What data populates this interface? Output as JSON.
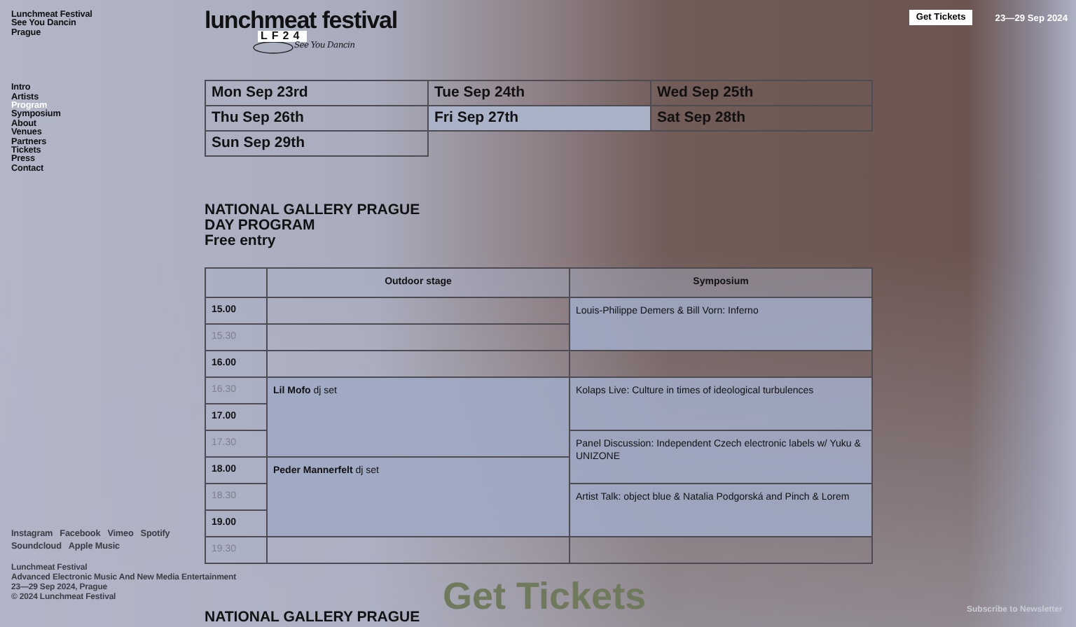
{
  "sidebar": {
    "site_lines": [
      "Lunchmeat Festival",
      "See You Dancin",
      "Prague"
    ],
    "nav": [
      {
        "label": "Intro",
        "selected": false
      },
      {
        "label": "Artists",
        "selected": false
      },
      {
        "label": "Program",
        "selected": true
      },
      {
        "label": "Symposium",
        "selected": false
      },
      {
        "label": "About",
        "selected": false
      },
      {
        "label": "Venues",
        "selected": false
      },
      {
        "label": "Partners",
        "selected": false
      },
      {
        "label": "Tickets",
        "selected": false
      },
      {
        "label": "Press",
        "selected": false
      },
      {
        "label": "Contact",
        "selected": false
      }
    ],
    "social": [
      "Instagram",
      "Facebook",
      "Vimeo",
      "Spotify",
      "Soundcloud",
      "Apple Music"
    ],
    "footer": [
      "Lunchmeat Festival",
      "Advanced Electronic Music And New Media Entertainment",
      "23—29 Sep 2024, Prague",
      "© 2024 Lunchmeat Festival"
    ]
  },
  "logo": {
    "title": "lunchmeat festival",
    "badge": "LF24",
    "script": "See You Dancin"
  },
  "header": {
    "button": "Get Tickets",
    "dates": "23—29 Sep 2024"
  },
  "days": [
    {
      "label": "Mon Sep 23rd",
      "selected": false
    },
    {
      "label": "Tue Sep 24th",
      "selected": false
    },
    {
      "label": "Wed Sep 25th",
      "selected": false
    },
    {
      "label": "Thu Sep 26th",
      "selected": false
    },
    {
      "label": "Fri Sep 27th",
      "selected": true
    },
    {
      "label": "Sat Sep 28th",
      "selected": false
    },
    {
      "label": "Sun Sep 29th",
      "selected": false
    }
  ],
  "venue": {
    "lines": [
      "NATIONAL GALLERY PRAGUE",
      "DAY PROGRAM",
      "Free entry"
    ]
  },
  "table": {
    "columns": [
      "Outdoor stage",
      "Symposium"
    ],
    "times": [
      {
        "text": "15.00",
        "kind": "hour"
      },
      {
        "text": "15.30",
        "kind": "half"
      },
      {
        "text": "16.00",
        "kind": "hour"
      },
      {
        "text": "16.30",
        "kind": "half"
      },
      {
        "text": "17.00",
        "kind": "hour"
      },
      {
        "text": "17.30",
        "kind": "half"
      },
      {
        "text": "18.00",
        "kind": "hour"
      },
      {
        "text": "18.30",
        "kind": "half"
      },
      {
        "text": "19.00",
        "kind": "hour"
      },
      {
        "text": "19.30",
        "kind": "half"
      }
    ],
    "stages": [
      [
        {
          "kind": "empty"
        },
        {
          "kind": "empty"
        },
        {
          "kind": "empty"
        },
        {
          "kind": "event",
          "text": "**Lil Mofo** dj set"
        },
        {
          "kind": "continued"
        },
        {
          "kind": "continued"
        },
        {
          "kind": "event",
          "text": "**Peder Mannerfelt** dj set"
        },
        {
          "kind": "continued"
        },
        {
          "kind": "continued"
        },
        {
          "kind": "empty"
        }
      ],
      [
        {
          "kind": "event",
          "text": "Louis-Philippe Demers & Bill Vorn: Inferno"
        },
        {
          "kind": "continued"
        },
        {
          "kind": "empty"
        },
        {
          "kind": "event",
          "text": "Kolaps Live: Culture in times of ideological turbulences"
        },
        {
          "kind": "continued"
        },
        {
          "kind": "event",
          "text": "Panel Discussion: Independent Czech electronic labels w/ Yuku & UNIZONE"
        },
        {
          "kind": "continued"
        },
        {
          "kind": "event",
          "text": "Artist Talk: object blue & Natalia Podgorská and Pinch & Lorem"
        },
        {
          "kind": "continued"
        },
        {
          "kind": "empty"
        }
      ]
    ]
  },
  "next_venue": "NATIONAL GALLERY PRAGUE",
  "floating_button": "Get Tickets",
  "newsletter": "Subscribe to Newsletter"
}
